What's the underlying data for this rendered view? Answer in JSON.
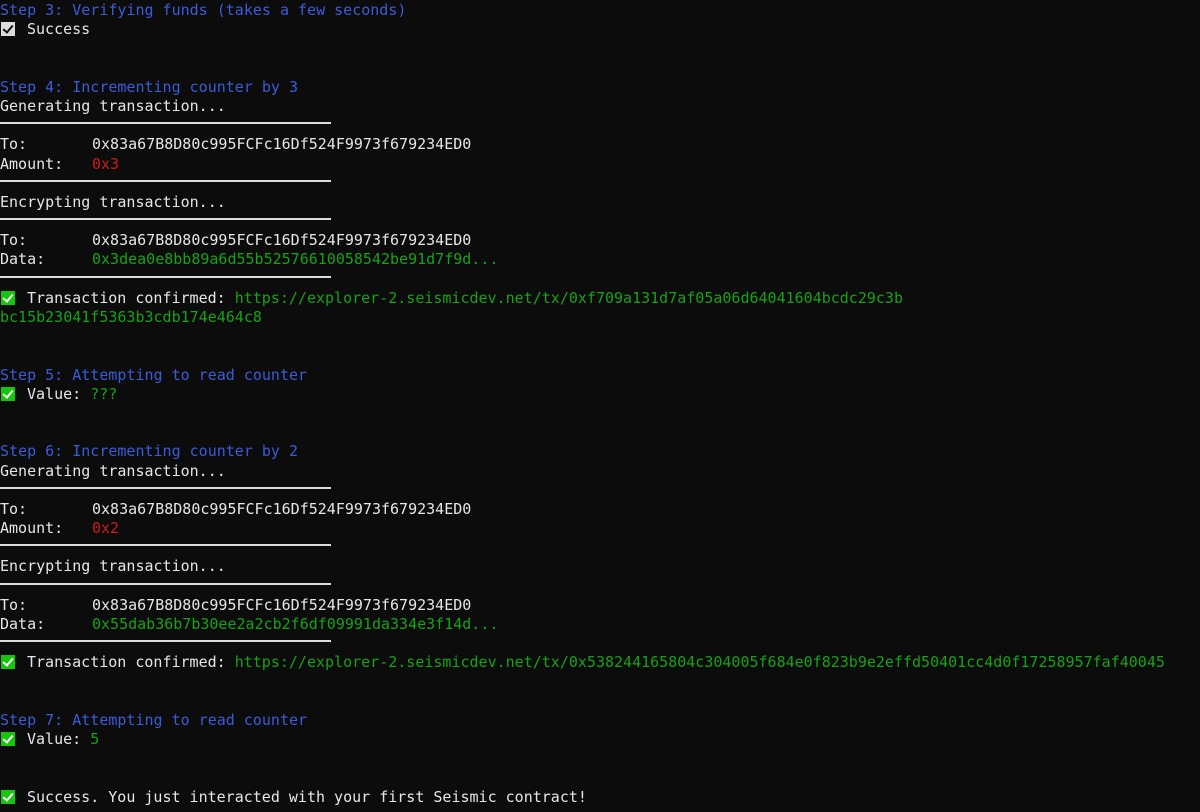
{
  "step3": {
    "title": "Step 3: Verifying funds (takes a few seconds)",
    "result": "Success"
  },
  "step4": {
    "title": "Step 4: Incrementing counter by 3",
    "generating": "Generating transaction...",
    "to_label": "To:",
    "to_value": "0x83a67B8D80c995FCFc16Df524F9973f679234ED0",
    "amount_label": "Amount:",
    "amount_value": "0x3",
    "encrypting": "Encrypting transaction...",
    "to2_label": "To:",
    "to2_value": "0x83a67B8D80c995FCFc16Df524F9973f679234ED0",
    "data_label": "Data:",
    "data_value": "0x3dea0e8bb89a6d55b52576610058542be91d7f9d...",
    "confirmed_label": "Transaction confirmed:",
    "confirmed_url_line1": "https://explorer-2.seismicdev.net/tx/0xf709a131d7af05a06d64041604bcdc29c3b",
    "confirmed_url_line2": "bc15b23041f5363b3cdb174e464c8"
  },
  "step5": {
    "title": "Step 5: Attempting to read counter",
    "value_label": "Value:",
    "value": "???"
  },
  "step6": {
    "title": "Step 6: Incrementing counter by 2",
    "generating": "Generating transaction...",
    "to_label": "To:",
    "to_value": "0x83a67B8D80c995FCFc16Df524F9973f679234ED0",
    "amount_label": "Amount:",
    "amount_value": "0x2",
    "encrypting": "Encrypting transaction...",
    "to2_label": "To:",
    "to2_value": "0x83a67B8D80c995FCFc16Df524F9973f679234ED0",
    "data_label": "Data:",
    "data_value": "0x55dab36b7b30ee2a2cb2f6df09991da334e3f14d...",
    "confirmed_label": "Transaction confirmed:",
    "confirmed_url": "https://explorer-2.seismicdev.net/tx/0x538244165804c304005f684e0f823b9e2effd50401cc4d0f17258957faf40045"
  },
  "step7": {
    "title": "Step 7: Attempting to read counter",
    "value_label": "Value:",
    "value": "5"
  },
  "final": {
    "message": "Success. You just interacted with your first Seismic contract!"
  },
  "colors": {
    "background": "#0c0c0c",
    "step_title": "#3b5bdb",
    "amount": "#d01a1a",
    "data_and_links": "#16a316",
    "check_green": "#16c60c",
    "check_grey": "#dcdcdc"
  },
  "icons": {
    "success_check": "check-box-icon"
  }
}
